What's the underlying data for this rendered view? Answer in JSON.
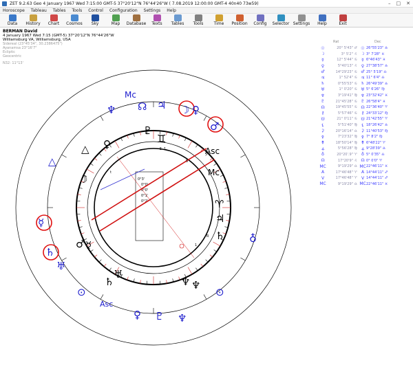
{
  "window": {
    "title": "ZET 9.2.63 Geo    4 January 1967  Wed    7:15:00 GMT-5 37°20'12\"N  76°44'26\"W  ( 7.08.2019  12:00:00 GMT-4 40n40 73w59)",
    "controls": [
      "–",
      "□",
      "✕"
    ]
  },
  "menu": [
    "Horoscope",
    "Tableau",
    "Tables",
    "Tools",
    "Control",
    "Configuration",
    "Settings",
    "Help"
  ],
  "toolbar": [
    {
      "label": "Data",
      "icon": "data-icon",
      "color": "#3a78c8"
    },
    {
      "label": "History",
      "icon": "history-icon",
      "color": "#c8a040"
    },
    {
      "label": "Chart",
      "icon": "chart-icon",
      "color": "#d04848"
    },
    {
      "label": "Cosmos",
      "icon": "cosmos-icon",
      "color": "#4a8ad0"
    },
    {
      "label": "Sky",
      "icon": "sky-icon",
      "color": "#2050a0"
    },
    {
      "label": "Map",
      "icon": "map-icon",
      "color": "#50a050"
    },
    {
      "label": "Database",
      "icon": "database-icon",
      "color": "#a07040"
    },
    {
      "label": "Texts",
      "icon": "texts-icon",
      "color": "#b050b0"
    },
    {
      "label": "Tables",
      "icon": "tables-icon",
      "color": "#6a9ad0"
    },
    {
      "label": "Tools",
      "icon": "tools-icon",
      "color": "#808080"
    },
    {
      "label": "Time",
      "icon": "time-icon",
      "color": "#d0a030"
    },
    {
      "label": "Position",
      "icon": "position-icon",
      "color": "#d06030"
    },
    {
      "label": "Config",
      "icon": "config-icon",
      "color": "#7070c0"
    },
    {
      "label": "Selector",
      "icon": "selector-icon",
      "color": "#3090c0"
    },
    {
      "label": "Settings",
      "icon": "settings-icon",
      "color": "#909090"
    },
    {
      "label": "Help",
      "icon": "help-icon",
      "color": "#4070c0"
    },
    {
      "label": "Exit",
      "icon": "exit-icon",
      "color": "#c04040"
    }
  ],
  "header": {
    "name": "BERMAN David",
    "datetime": "4 January 1967  Wed    7:15 (GMT-5) 37°20'12\"N  76°44'26\"W",
    "place": "Williamsburg VA, Williamsburg, USA",
    "zodiac": "Sidereal (23°45'34\", 30.2386475\")",
    "ayanamsa": "Ayanamsa 23°16'7\"",
    "ecliptic": "Ecliptic",
    "mode": "Geocentric",
    "aspect": "N32: 11°13'"
  },
  "colors": {
    "planet": "#1a1acc",
    "highlight": "#e01010",
    "ring": "#000000",
    "accent": "#e02020"
  },
  "chart_labels": {
    "mc_outer": "Mc",
    "asc_outer": "Asc",
    "asc_inner": "Asc",
    "mc_inner": "Mc",
    "r": "R",
    "inner_t": "t",
    "inner_s1": "5",
    "inner_s2": "1",
    "inner_s3": "5",
    "inner_s4": "1",
    "box1": "0°3'",
    "box2": "0°0'",
    "box3": "0°0'",
    "box4": "0°1'",
    "box5": "0°2'"
  },
  "table": {
    "header_left": "Rat",
    "header_right": "Dec",
    "rows": [
      {
        "g1": "☉",
        "lat": "20° 5'43\" ♂",
        "g2": "☉",
        "dec": "26°55'23\" ♎"
      },
      {
        "g1": "☽",
        "lat": "3° 5'2\" ♌",
        "g2": "☽",
        "dec": "3° 7'28\" ♓"
      },
      {
        "g1": "☿",
        "lat": "12° 5'44\" ♋",
        "g2": "☿",
        "dec": "6°46'43\" ♓"
      },
      {
        "g1": "♀",
        "lat": "5°40'13\" ♌",
        "g2": "♀",
        "dec": "27°38'57\" ♎"
      },
      {
        "g1": "♂",
        "lat": "14°29'23\" ♋",
        "g2": "♂",
        "dec": "25° 5'19\" ♎"
      },
      {
        "g1": "♃",
        "lat": "1° 52'4\" ♋",
        "g2": "♃",
        "dec": "11° 6'4\" ♎"
      },
      {
        "g1": "♄",
        "lat": "0°55'53\" ♋",
        "g2": "♄",
        "dec": "26°49'39\" ♎"
      },
      {
        "g1": "♅",
        "lat": "1° 0'20\" ♋",
        "g2": "♅",
        "dec": "5° 6'26\" ♍"
      },
      {
        "g1": "♆",
        "lat": "3°19'41\" ♍",
        "g2": "♆",
        "dec": "23°32'42\" ♓"
      },
      {
        "g1": "♇",
        "lat": "21°45'28\" ♋",
        "g2": "♇",
        "dec": "26°58'4\" ♓"
      },
      {
        "g1": "☊",
        "lat": "19°45'55\" ♋",
        "g2": "☊",
        "dec": "22°36'40\" ♈"
      },
      {
        "g1": "⚷",
        "lat": "5°57'46\" ♋",
        "g2": "⚷",
        "dec": "24°33'12\" ♍"
      },
      {
        "g1": "☋",
        "lat": "21° 0'11\" ♋",
        "g2": "☋",
        "dec": "21°42'55\" ♈"
      },
      {
        "g1": "⚸",
        "lat": "5°51'40\" ♍",
        "g2": "⚸",
        "dec": "18°26'42\" ♎"
      },
      {
        "g1": "⚳",
        "lat": "20°16'14\" ♎",
        "g2": "⚳",
        "dec": "11°40'53\" ♍"
      },
      {
        "g1": "⚴",
        "lat": "7°23'32\" ♍",
        "g2": "⚴",
        "dec": "7° 8'2\" ♍"
      },
      {
        "g1": "⚵",
        "lat": "18°50'14\" ♍",
        "g2": "⚵",
        "dec": "6°48'22\" ♈"
      },
      {
        "g1": "⚶",
        "lat": "5°56'28\" ♍",
        "g2": "⚶",
        "dec": "9°28'39\" ♎"
      },
      {
        "g1": "♁",
        "lat": "20°20'.9\" ♈",
        "g2": "♁",
        "dec": "5° 0'35\" ♎"
      },
      {
        "g1": "☊",
        "lat": "17°20'9\" ♌",
        "g2": "☊",
        "dec": "0° 0'0\" ♈"
      },
      {
        "g1": "MC",
        "lat": "9°19'29\" ♎",
        "g2": "MC",
        "dec": "22°46'11\" ♓"
      },
      {
        "g1": "A",
        "lat": "17°46'48\" ♈",
        "g2": "A",
        "dec": "14°44'11\" ♐"
      },
      {
        "g1": "V",
        "lat": "17°46'48\" ♈",
        "g2": "V",
        "dec": "14°44'11\" ♐"
      },
      {
        "g1": "MC",
        "lat": "9°19'29\" ♎",
        "g2": "MC",
        "dec": "22°46'11\" ♓"
      }
    ]
  }
}
